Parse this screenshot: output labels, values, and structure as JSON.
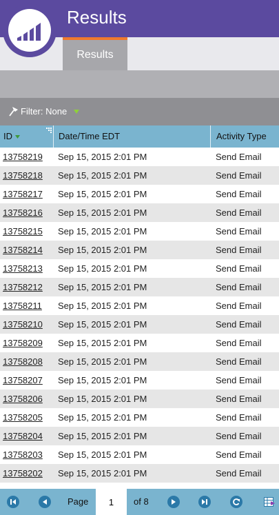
{
  "header": {
    "title": "Results"
  },
  "tabs": [
    {
      "label": "Results"
    }
  ],
  "filter": {
    "label": "Filter: None"
  },
  "grid": {
    "columns": [
      "ID",
      "Date/Time EDT",
      "Activity Type"
    ],
    "rows": [
      {
        "id": "13758219",
        "datetime": "Sep 15, 2015 2:01 PM",
        "activity": "Send Email"
      },
      {
        "id": "13758218",
        "datetime": "Sep 15, 2015 2:01 PM",
        "activity": "Send Email"
      },
      {
        "id": "13758217",
        "datetime": "Sep 15, 2015 2:01 PM",
        "activity": "Send Email"
      },
      {
        "id": "13758216",
        "datetime": "Sep 15, 2015 2:01 PM",
        "activity": "Send Email"
      },
      {
        "id": "13758215",
        "datetime": "Sep 15, 2015 2:01 PM",
        "activity": "Send Email"
      },
      {
        "id": "13758214",
        "datetime": "Sep 15, 2015 2:01 PM",
        "activity": "Send Email"
      },
      {
        "id": "13758213",
        "datetime": "Sep 15, 2015 2:01 PM",
        "activity": "Send Email"
      },
      {
        "id": "13758212",
        "datetime": "Sep 15, 2015 2:01 PM",
        "activity": "Send Email"
      },
      {
        "id": "13758211",
        "datetime": "Sep 15, 2015 2:01 PM",
        "activity": "Send Email"
      },
      {
        "id": "13758210",
        "datetime": "Sep 15, 2015 2:01 PM",
        "activity": "Send Email"
      },
      {
        "id": "13758209",
        "datetime": "Sep 15, 2015 2:01 PM",
        "activity": "Send Email"
      },
      {
        "id": "13758208",
        "datetime": "Sep 15, 2015 2:01 PM",
        "activity": "Send Email"
      },
      {
        "id": "13758207",
        "datetime": "Sep 15, 2015 2:01 PM",
        "activity": "Send Email"
      },
      {
        "id": "13758206",
        "datetime": "Sep 15, 2015 2:01 PM",
        "activity": "Send Email"
      },
      {
        "id": "13758205",
        "datetime": "Sep 15, 2015 2:01 PM",
        "activity": "Send Email"
      },
      {
        "id": "13758204",
        "datetime": "Sep 15, 2015 2:01 PM",
        "activity": "Send Email"
      },
      {
        "id": "13758203",
        "datetime": "Sep 15, 2015 2:01 PM",
        "activity": "Send Email"
      },
      {
        "id": "13758202",
        "datetime": "Sep 15, 2015 2:01 PM",
        "activity": "Send Email"
      }
    ]
  },
  "pager": {
    "page_label": "Page",
    "current_page": "1",
    "of_label": "of 8"
  },
  "icons": {
    "logo": "marketo-bars-logo",
    "filter": "funnel-pin-icon",
    "first": "first-page-icon",
    "prev": "prev-page-icon",
    "next": "next-page-icon",
    "last": "last-page-icon",
    "refresh": "refresh-icon",
    "export": "export-grid-icon"
  },
  "colors": {
    "header": "#5b4a9f",
    "tab_accent": "#ef7a2e",
    "grid_header": "#7ab4cf",
    "pager_button": "#2b79a8"
  }
}
